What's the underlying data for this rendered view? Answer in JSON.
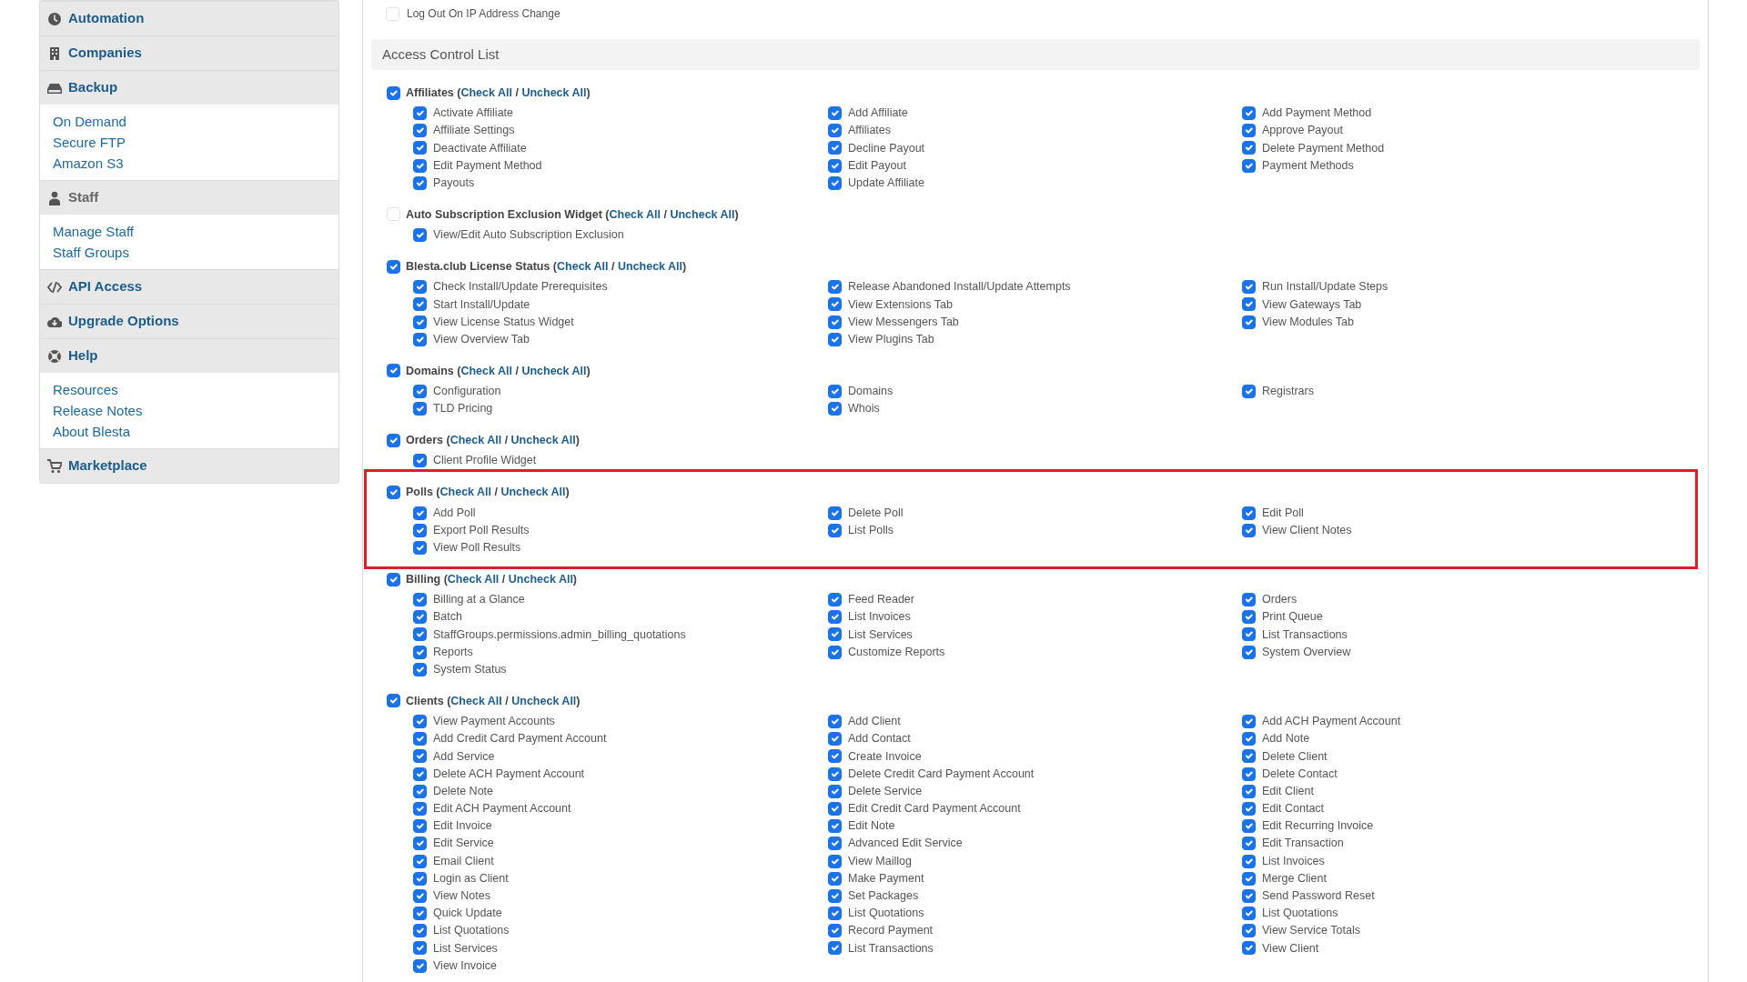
{
  "sidebar": {
    "sections": [
      {
        "title": "Automation",
        "selected": false
      },
      {
        "title": "Companies",
        "selected": false
      },
      {
        "title": "Backup",
        "selected": false,
        "links": [
          "On Demand",
          "Secure FTP",
          "Amazon S3"
        ]
      },
      {
        "title": "Staff",
        "selected": true,
        "links": [
          "Manage Staff",
          "Staff Groups"
        ]
      },
      {
        "title": "API Access",
        "selected": false
      },
      {
        "title": "Upgrade Options",
        "selected": false
      },
      {
        "title": "Help",
        "selected": false,
        "links": [
          "Resources",
          "Release Notes",
          "About Blesta"
        ]
      },
      {
        "title": "Marketplace",
        "selected": false
      }
    ]
  },
  "top_option": {
    "label": "Log Out On IP Address Change",
    "checked": false
  },
  "acl": {
    "title": "Access Control List",
    "groups": [
      {
        "title": "Affiliates",
        "checked": true,
        "highlighted": false,
        "open": "(",
        "check_all": "Check All",
        "separator": "/",
        "uncheck_all": "Uncheck All",
        "close": ")",
        "columns": [
          [
            {
              "label": "Activate Affiliate",
              "checked": true
            },
            {
              "label": "Affiliate Settings",
              "checked": true
            },
            {
              "label": "Deactivate Affiliate",
              "checked": true
            },
            {
              "label": "Edit Payment Method",
              "checked": true
            },
            {
              "label": "Payouts",
              "checked": true
            }
          ],
          [
            {
              "label": "Add Affiliate",
              "checked": true
            },
            {
              "label": "Affiliates",
              "checked": true
            },
            {
              "label": "Decline Payout",
              "checked": true
            },
            {
              "label": "Edit Payout",
              "checked": true
            },
            {
              "label": "Update Affiliate",
              "checked": true
            }
          ],
          [
            {
              "label": "Add Payment Method",
              "checked": true
            },
            {
              "label": "Approve Payout",
              "checked": true
            },
            {
              "label": "Delete Payment Method",
              "checked": true
            },
            {
              "label": "Payment Methods",
              "checked": true
            }
          ]
        ]
      },
      {
        "title": "Auto Subscription Exclusion Widget",
        "checked": false,
        "highlighted": false,
        "open": "(",
        "check_all": "Check All",
        "separator": "/",
        "uncheck_all": "Uncheck All",
        "close": ")",
        "columns": [
          [
            {
              "label": "View/Edit Auto Subscription Exclusion",
              "checked": true
            }
          ]
        ]
      },
      {
        "title": "Blesta.club License Status",
        "checked": true,
        "highlighted": false,
        "open": "(",
        "check_all": "Check All",
        "separator": "/",
        "uncheck_all": "Uncheck All",
        "close": ")",
        "columns": [
          [
            {
              "label": "Check Install/Update Prerequisites",
              "checked": true
            },
            {
              "label": "Start Install/Update",
              "checked": true
            },
            {
              "label": "View License Status Widget",
              "checked": true
            },
            {
              "label": "View Overview Tab",
              "checked": true
            }
          ],
          [
            {
              "label": "Release Abandoned Install/Update Attempts",
              "checked": true
            },
            {
              "label": "View Extensions Tab",
              "checked": true
            },
            {
              "label": "View Messengers Tab",
              "checked": true
            },
            {
              "label": "View Plugins Tab",
              "checked": true
            }
          ],
          [
            {
              "label": "Run Install/Update Steps",
              "checked": true
            },
            {
              "label": "View Gateways Tab",
              "checked": true
            },
            {
              "label": "View Modules Tab",
              "checked": true
            }
          ]
        ]
      },
      {
        "title": "Domains",
        "checked": true,
        "highlighted": false,
        "open": "(",
        "check_all": "Check All",
        "separator": "/",
        "uncheck_all": "Uncheck All",
        "close": ")",
        "columns": [
          [
            {
              "label": "Configuration",
              "checked": true
            },
            {
              "label": "TLD Pricing",
              "checked": true
            }
          ],
          [
            {
              "label": "Domains",
              "checked": true
            },
            {
              "label": "Whois",
              "checked": true
            }
          ],
          [
            {
              "label": "Registrars",
              "checked": true
            }
          ]
        ]
      },
      {
        "title": "Orders",
        "checked": true,
        "highlighted": false,
        "open": "(",
        "check_all": "Check All",
        "separator": "/",
        "uncheck_all": "Uncheck All",
        "close": ")",
        "columns": [
          [
            {
              "label": "Client Profile Widget",
              "checked": true
            }
          ]
        ]
      },
      {
        "title": "Polls",
        "checked": true,
        "highlighted": true,
        "open": "(",
        "check_all": "Check All",
        "separator": "/",
        "uncheck_all": "Uncheck All",
        "close": ")",
        "columns": [
          [
            {
              "label": "Add Poll",
              "checked": true
            },
            {
              "label": "Export Poll Results",
              "checked": true
            },
            {
              "label": "View Poll Results",
              "checked": true
            }
          ],
          [
            {
              "label": "Delete Poll",
              "checked": true
            },
            {
              "label": "List Polls",
              "checked": true
            }
          ],
          [
            {
              "label": "Edit Poll",
              "checked": true
            },
            {
              "label": "View Client Notes",
              "checked": true
            }
          ]
        ]
      },
      {
        "title": "Billing",
        "checked": true,
        "highlighted": false,
        "open": "(",
        "check_all": "Check All",
        "separator": "/",
        "uncheck_all": "Uncheck All",
        "close": ")",
        "columns": [
          [
            {
              "label": "Billing at a Glance",
              "checked": true
            },
            {
              "label": "Batch",
              "checked": true
            },
            {
              "label": "StaffGroups.permissions.admin_billing_quotations",
              "checked": true
            },
            {
              "label": "Reports",
              "checked": true
            },
            {
              "label": "System Status",
              "checked": true
            }
          ],
          [
            {
              "label": "Feed Reader",
              "checked": true
            },
            {
              "label": "List Invoices",
              "checked": true
            },
            {
              "label": "List Services",
              "checked": true
            },
            {
              "label": "Customize Reports",
              "checked": true
            }
          ],
          [
            {
              "label": "Orders",
              "checked": true
            },
            {
              "label": "Print Queue",
              "checked": true
            },
            {
              "label": "List Transactions",
              "checked": true
            },
            {
              "label": "System Overview",
              "checked": true
            }
          ]
        ]
      },
      {
        "title": "Clients",
        "checked": true,
        "highlighted": false,
        "open": "(",
        "check_all": "Check All",
        "separator": "/",
        "uncheck_all": "Uncheck All",
        "close": ")",
        "columns": [
          [
            {
              "label": "View Payment Accounts",
              "checked": true
            },
            {
              "label": "Add Credit Card Payment Account",
              "checked": true
            },
            {
              "label": "Add Service",
              "checked": true
            },
            {
              "label": "Delete ACH Payment Account",
              "checked": true
            },
            {
              "label": "Delete Note",
              "checked": true
            },
            {
              "label": "Edit ACH Payment Account",
              "checked": true
            },
            {
              "label": "Edit Invoice",
              "checked": true
            },
            {
              "label": "Edit Service",
              "checked": true
            },
            {
              "label": "Email Client",
              "checked": true
            },
            {
              "label": "Login as Client",
              "checked": true
            },
            {
              "label": "View Notes",
              "checked": true
            },
            {
              "label": "Quick Update",
              "checked": true
            },
            {
              "label": "List Quotations",
              "checked": true
            },
            {
              "label": "List Services",
              "checked": true
            },
            {
              "label": "View Invoice",
              "checked": true
            }
          ],
          [
            {
              "label": "Add Client",
              "checked": true
            },
            {
              "label": "Add Contact",
              "checked": true
            },
            {
              "label": "Create Invoice",
              "checked": true
            },
            {
              "label": "Delete Credit Card Payment Account",
              "checked": true
            },
            {
              "label": "Delete Service",
              "checked": true
            },
            {
              "label": "Edit Credit Card Payment Account",
              "checked": true
            },
            {
              "label": "Edit Note",
              "checked": true
            },
            {
              "label": "Advanced Edit Service",
              "checked": true
            },
            {
              "label": "View Maillog",
              "checked": true
            },
            {
              "label": "Make Payment",
              "checked": true
            },
            {
              "label": "Set Packages",
              "checked": true
            },
            {
              "label": "List Quotations",
              "checked": true
            },
            {
              "label": "Record Payment",
              "checked": true
            },
            {
              "label": "List Transactions",
              "checked": true
            }
          ],
          [
            {
              "label": "Add ACH Payment Account",
              "checked": true
            },
            {
              "label": "Add Note",
              "checked": true
            },
            {
              "label": "Delete Client",
              "checked": true
            },
            {
              "label": "Delete Contact",
              "checked": true
            },
            {
              "label": "Edit Client",
              "checked": true
            },
            {
              "label": "Edit Contact",
              "checked": true
            },
            {
              "label": "Edit Recurring Invoice",
              "checked": true
            },
            {
              "label": "Edit Transaction",
              "checked": true
            },
            {
              "label": "List Invoices",
              "checked": true
            },
            {
              "label": "Merge Client",
              "checked": true
            },
            {
              "label": "Send Password Reset",
              "checked": true
            },
            {
              "label": "List Quotations",
              "checked": true
            },
            {
              "label": "View Service Totals",
              "checked": true
            },
            {
              "label": "View Client",
              "checked": true
            }
          ]
        ]
      }
    ]
  }
}
